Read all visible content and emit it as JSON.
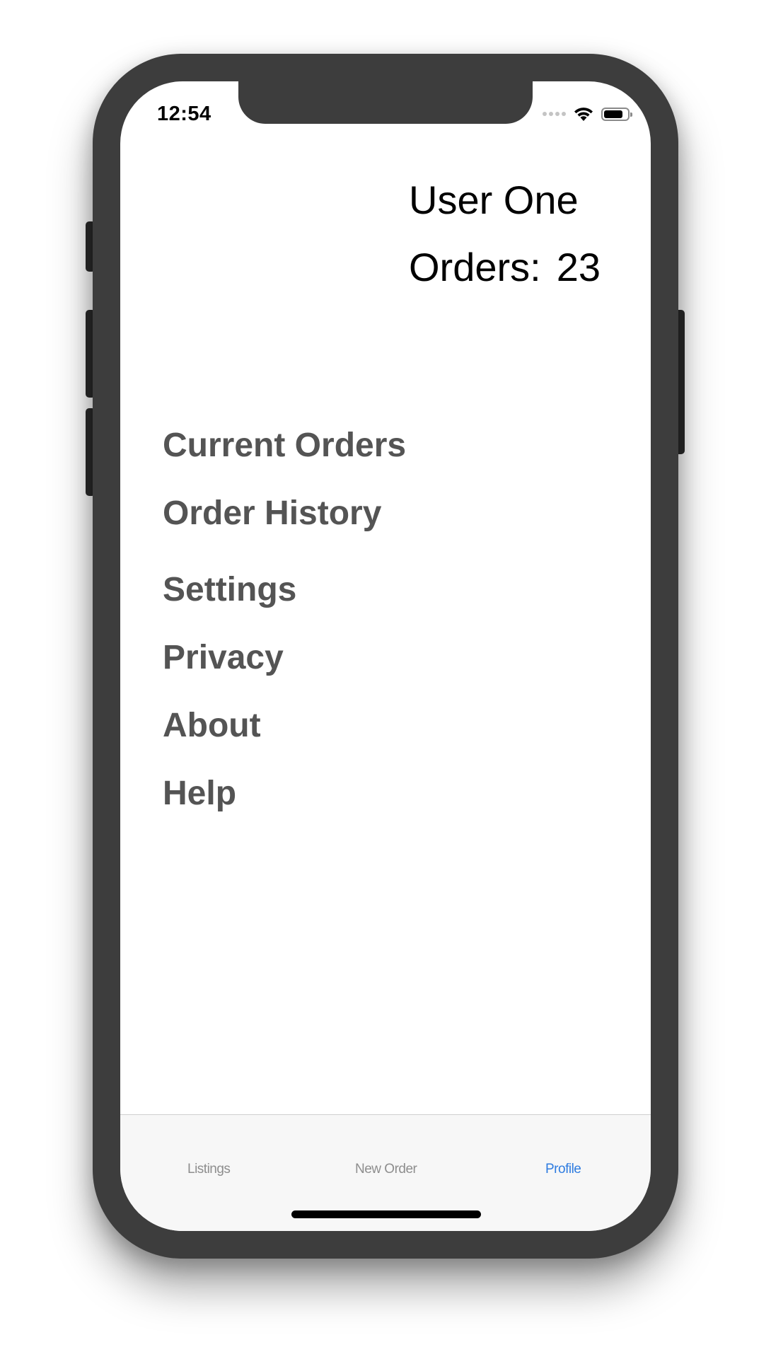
{
  "status_bar": {
    "time": "12:54",
    "icons": [
      "signal-dots-icon",
      "wifi-icon",
      "battery-icon"
    ]
  },
  "profile": {
    "name": "User One",
    "orders_label": "Orders:",
    "orders_count": "23"
  },
  "menu": {
    "items": [
      {
        "label": "Current Orders"
      },
      {
        "label": "Order History"
      },
      {
        "label": "Settings"
      },
      {
        "label": "Privacy"
      },
      {
        "label": "About"
      },
      {
        "label": "Help"
      }
    ]
  },
  "tab_bar": {
    "tabs": [
      {
        "label": "Listings"
      },
      {
        "label": "New Order"
      },
      {
        "label": "Profile",
        "active": true
      }
    ],
    "active_color": "#2f7ce0",
    "inactive_color": "#8e8e8e"
  },
  "colors": {
    "device_frame": "#3d3d3d",
    "menu_text": "#545454"
  }
}
